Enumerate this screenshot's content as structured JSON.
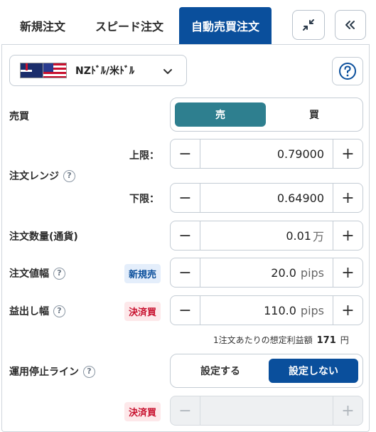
{
  "tabs": [
    {
      "label": "新規注文"
    },
    {
      "label": "スピード注文"
    },
    {
      "label": "自動売買注文"
    }
  ],
  "currency_pair": {
    "label": "NZﾄﾞﾙ/米ﾄﾞﾙ"
  },
  "buysell": {
    "label": "売買",
    "sell": "売",
    "buy": "買",
    "selected": "sell"
  },
  "range": {
    "label": "注文レンジ",
    "upper_label": "上限：",
    "upper_value": "0.79000",
    "lower_label": "下限：",
    "lower_value": "0.64900"
  },
  "quantity": {
    "label": "注文数量(通貨)",
    "value": "0.01",
    "unit": "万"
  },
  "order_width": {
    "label": "注文値幅",
    "badge": "新規売",
    "value": "20.0",
    "unit": "pips"
  },
  "profit_width": {
    "label": "益出し幅",
    "badge": "決済買",
    "value": "110.0",
    "unit": "pips"
  },
  "expected_profit": {
    "label": "1注文あたりの想定利益額",
    "value": "171",
    "unit": "円"
  },
  "stop_line": {
    "label": "運用停止ライン",
    "set": "設定する",
    "unset": "設定しない",
    "selected": "unset"
  },
  "stop_row": {
    "badge": "決済買",
    "value": ""
  },
  "colors": {
    "primary": "#0a4f9c",
    "sell_active": "#2e7f8f",
    "settle_badge": "#c8102e"
  }
}
